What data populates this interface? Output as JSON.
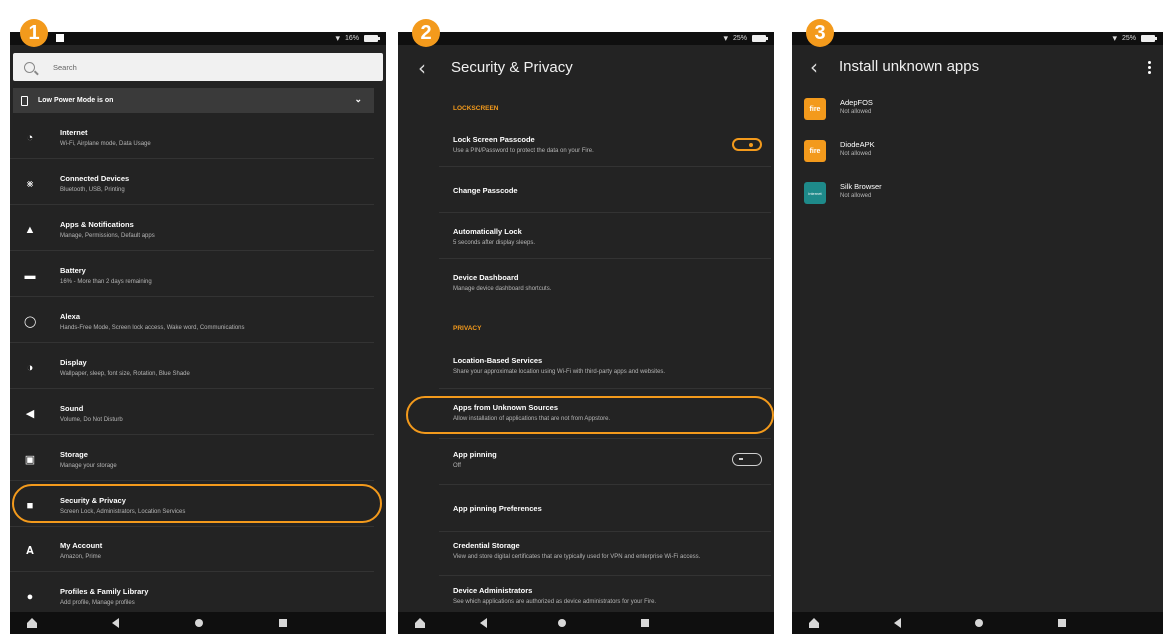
{
  "badges": [
    "1",
    "2",
    "3"
  ],
  "panel1": {
    "status_battery": "16%",
    "search_placeholder": "Search",
    "low_power": "Low Power Mode is on",
    "items": [
      {
        "title": "Internet",
        "subtitle": "Wi-Fi, Airplane mode, Data Usage",
        "icon": "wifi-icon"
      },
      {
        "title": "Connected Devices",
        "subtitle": "Bluetooth, USB, Printing",
        "icon": "bluetooth-icon"
      },
      {
        "title": "Apps & Notifications",
        "subtitle": "Manage, Permissions, Default apps",
        "icon": "bell-icon"
      },
      {
        "title": "Battery",
        "subtitle": "16% - More than 2 days remaining",
        "icon": "battery-icon"
      },
      {
        "title": "Alexa",
        "subtitle": "Hands-Free Mode, Screen lock access, Wake word, Communications",
        "icon": "alexa-icon"
      },
      {
        "title": "Display",
        "subtitle": "Wallpaper, sleep, font size, Rotation, Blue Shade",
        "icon": "display-icon"
      },
      {
        "title": "Sound",
        "subtitle": "Volume, Do Not Disturb",
        "icon": "speaker-icon"
      },
      {
        "title": "Storage",
        "subtitle": "Manage your storage",
        "icon": "storage-icon"
      },
      {
        "title": "Security & Privacy",
        "subtitle": "Screen Lock, Administrators, Location Services",
        "icon": "lock-icon"
      },
      {
        "title": "My Account",
        "subtitle": "Amazon, Prime",
        "icon": "account-icon"
      },
      {
        "title": "Profiles & Family Library",
        "subtitle": "Add profile, Manage profiles",
        "icon": "people-icon"
      }
    ]
  },
  "panel2": {
    "status_battery": "25%",
    "title": "Security & Privacy",
    "section_lockscreen": "LOCKSCREEN",
    "section_privacy": "PRIVACY",
    "rows": [
      {
        "title": "Lock Screen Passcode",
        "subtitle": "Use a PIN/Password to protect the data on your Fire."
      },
      {
        "title": "Change Passcode",
        "subtitle": ""
      },
      {
        "title": "Automatically Lock",
        "subtitle": "5 seconds after display sleeps."
      },
      {
        "title": "Device Dashboard",
        "subtitle": "Manage device dashboard shortcuts."
      },
      {
        "title": "Location-Based Services",
        "subtitle": "Share your approximate location using Wi-Fi with third-party apps and websites."
      },
      {
        "title": "Apps from Unknown Sources",
        "subtitle": "Allow installation of applications that are not from Appstore."
      },
      {
        "title": "App pinning",
        "subtitle": "Off"
      },
      {
        "title": "App pinning Preferences",
        "subtitle": ""
      },
      {
        "title": "Credential Storage",
        "subtitle": "View and store digital certificates that are typically used for VPN and enterprise Wi-Fi access."
      },
      {
        "title": "Device Administrators",
        "subtitle": "See which applications are authorized as device administrators for your Fire."
      }
    ]
  },
  "panel3": {
    "status_battery": "25%",
    "title": "Install unknown apps",
    "apps": [
      {
        "name": "AdepFOS",
        "status": "Not allowed",
        "icon_text": "fire"
      },
      {
        "name": "DiodeAPK",
        "status": "Not allowed",
        "icon_text": "fire"
      },
      {
        "name": "Silk Browser",
        "status": "Not allowed",
        "icon_text": "internet"
      }
    ]
  },
  "colors": {
    "accent": "#f39a1c",
    "background": "#232323",
    "bars": "#0f0f0f"
  }
}
